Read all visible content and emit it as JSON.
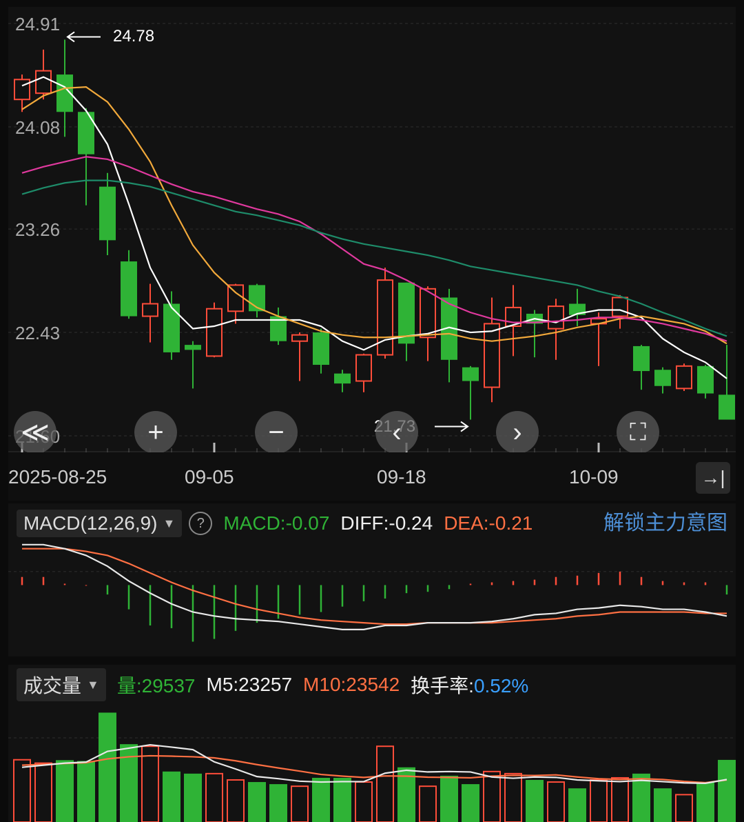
{
  "colors": {
    "up": "#ff4d3a",
    "down": "#2fb336",
    "ma5": "#ffffff",
    "ma10": "#f2a93b",
    "ma20": "#e0399e",
    "ma60": "#1e8c6a",
    "diff": "#e8e8e8",
    "dea": "#ff7043",
    "turnover": "#3aa0ff",
    "link": "#4d8fd6"
  },
  "chart_data": [
    {
      "type": "candlestick",
      "ylim": [
        21.6,
        24.91
      ],
      "y_ticks": [
        "24.91",
        "24.08",
        "23.26",
        "22.43",
        "21.60"
      ],
      "x_ticks": [
        {
          "index": 0,
          "label": "2025-08-25"
        },
        {
          "index": 9,
          "label": "09-05"
        },
        {
          "index": 18,
          "label": "09-18"
        },
        {
          "index": 27,
          "label": "10-09"
        }
      ],
      "candles": [
        {
          "o": 24.3,
          "c": 24.46,
          "h": 24.5,
          "l": 24.2
        },
        {
          "o": 24.35,
          "c": 24.53,
          "h": 24.7,
          "l": 24.3
        },
        {
          "o": 24.5,
          "c": 24.2,
          "h": 24.78,
          "l": 24.0
        },
        {
          "o": 24.2,
          "c": 23.86,
          "h": 24.23,
          "l": 23.45
        },
        {
          "o": 23.6,
          "c": 23.17,
          "h": 23.71,
          "l": 23.05
        },
        {
          "o": 23.0,
          "c": 22.56,
          "h": 23.09,
          "l": 22.54
        },
        {
          "o": 22.56,
          "c": 22.66,
          "h": 22.82,
          "l": 22.35
        },
        {
          "o": 22.66,
          "c": 22.27,
          "h": 22.76,
          "l": 22.21
        },
        {
          "o": 22.33,
          "c": 22.29,
          "h": 22.36,
          "l": 21.98
        },
        {
          "o": 22.24,
          "c": 22.62,
          "h": 22.67,
          "l": 22.23
        },
        {
          "o": 22.6,
          "c": 22.81,
          "h": 22.82,
          "l": 22.5
        },
        {
          "o": 22.81,
          "c": 22.6,
          "h": 22.82,
          "l": 22.55
        },
        {
          "o": 22.56,
          "c": 22.36,
          "h": 22.63,
          "l": 22.33
        },
        {
          "o": 22.36,
          "c": 22.41,
          "h": 22.43,
          "l": 22.04
        },
        {
          "o": 22.43,
          "c": 22.17,
          "h": 22.46,
          "l": 22.1
        },
        {
          "o": 22.1,
          "c": 22.02,
          "h": 22.13,
          "l": 21.95
        },
        {
          "o": 22.04,
          "c": 22.25,
          "h": 22.26,
          "l": 21.95
        },
        {
          "o": 22.25,
          "c": 22.85,
          "h": 22.95,
          "l": 22.22
        },
        {
          "o": 22.83,
          "c": 22.34,
          "h": 22.83,
          "l": 22.2
        },
        {
          "o": 22.39,
          "c": 22.78,
          "h": 22.8,
          "l": 22.2
        },
        {
          "o": 22.71,
          "c": 22.21,
          "h": 22.78,
          "l": 22.03
        },
        {
          "o": 22.15,
          "c": 22.04,
          "h": 22.16,
          "l": 21.73
        },
        {
          "o": 21.99,
          "c": 22.5,
          "h": 22.71,
          "l": 21.87
        },
        {
          "o": 22.48,
          "c": 22.63,
          "h": 22.81,
          "l": 22.24
        },
        {
          "o": 22.58,
          "c": 22.5,
          "h": 22.61,
          "l": 22.23
        },
        {
          "o": 22.46,
          "c": 22.64,
          "h": 22.7,
          "l": 22.21
        },
        {
          "o": 22.66,
          "c": 22.57,
          "h": 22.78,
          "l": 22.48
        },
        {
          "o": 22.5,
          "c": 22.54,
          "h": 22.59,
          "l": 22.16
        },
        {
          "o": 22.56,
          "c": 22.71,
          "h": 22.73,
          "l": 22.46
        },
        {
          "o": 22.32,
          "c": 22.12,
          "h": 22.33,
          "l": 21.97
        },
        {
          "o": 22.13,
          "c": 22.0,
          "h": 22.15,
          "l": 21.94
        },
        {
          "o": 21.98,
          "c": 22.16,
          "h": 22.18,
          "l": 21.96
        },
        {
          "o": 22.16,
          "c": 21.94,
          "h": 22.17,
          "l": 21.9
        },
        {
          "o": 21.93,
          "c": 21.73,
          "h": 22.33,
          "l": 21.73
        }
      ],
      "ma_lines": [
        {
          "key": "ma5",
          "values": [
            24.41,
            24.48,
            24.4,
            24.21,
            23.94,
            23.46,
            22.95,
            22.63,
            22.46,
            22.48,
            22.53,
            22.53,
            22.53,
            22.53,
            22.48,
            22.36,
            22.29,
            22.37,
            22.4,
            22.42,
            22.47,
            22.43,
            22.44,
            22.49,
            22.54,
            22.51,
            22.58,
            22.61,
            22.61,
            22.55,
            22.38,
            22.27,
            22.19,
            22.06
          ]
        },
        {
          "key": "ma10",
          "values": [
            24.22,
            24.33,
            24.39,
            24.4,
            24.28,
            24.06,
            23.8,
            23.45,
            23.13,
            22.91,
            22.75,
            22.63,
            22.56,
            22.5,
            22.44,
            22.41,
            22.39,
            22.39,
            22.4,
            22.41,
            22.42,
            22.38,
            22.36,
            22.38,
            22.4,
            22.43,
            22.47,
            22.5,
            22.54,
            22.56,
            22.53,
            22.5,
            22.44,
            22.34
          ]
        },
        {
          "key": "ma20",
          "values": [
            23.71,
            23.76,
            23.8,
            23.84,
            23.82,
            23.76,
            23.69,
            23.62,
            23.56,
            23.52,
            23.47,
            23.42,
            23.38,
            23.32,
            23.22,
            23.1,
            22.98,
            22.93,
            22.85,
            22.76,
            22.66,
            22.59,
            22.54,
            22.51,
            22.51,
            22.52,
            22.53,
            22.55,
            22.55,
            22.53,
            22.5,
            22.46,
            22.42,
            22.36
          ]
        },
        {
          "key": "ma60",
          "values": [
            23.54,
            23.59,
            23.63,
            23.65,
            23.65,
            23.63,
            23.6,
            23.55,
            23.5,
            23.45,
            23.4,
            23.37,
            23.33,
            23.29,
            23.23,
            23.18,
            23.14,
            23.11,
            23.08,
            23.05,
            23.01,
            22.96,
            22.93,
            22.9,
            22.87,
            22.84,
            22.81,
            22.76,
            22.72,
            22.66,
            22.59,
            22.53,
            22.46,
            22.4
          ]
        }
      ],
      "annotations": [
        {
          "text": "24.78",
          "index": 2,
          "value": 24.78,
          "side": "right"
        },
        {
          "text": "21.73",
          "index": 21,
          "value": 21.73,
          "side": "left"
        }
      ]
    },
    {
      "type": "macd",
      "params": "MACD(12,26,9)",
      "latest": {
        "macd": "MACD:-0.07",
        "diff": "DIFF:-0.24",
        "dea": "DEA:-0.21"
      },
      "ylim": [
        -0.52,
        0.34
      ],
      "hist": [
        0.06,
        0.06,
        0.01,
        0,
        -0.07,
        -0.18,
        -0.3,
        -0.32,
        -0.42,
        -0.4,
        -0.34,
        -0.28,
        -0.25,
        -0.22,
        -0.2,
        -0.16,
        -0.12,
        -0.1,
        -0.06,
        -0.05,
        -0.03,
        0.01,
        0.02,
        0.03,
        0.04,
        0.06,
        0.07,
        0.09,
        0.1,
        0.06,
        0.03,
        0.02,
        0.02,
        -0.07
      ],
      "diff": [
        0.3,
        0.3,
        0.27,
        0.22,
        0.14,
        0.03,
        -0.06,
        -0.14,
        -0.2,
        -0.23,
        -0.25,
        -0.26,
        -0.27,
        -0.29,
        -0.31,
        -0.33,
        -0.33,
        -0.3,
        -0.3,
        -0.28,
        -0.28,
        -0.28,
        -0.27,
        -0.25,
        -0.22,
        -0.21,
        -0.18,
        -0.17,
        -0.15,
        -0.16,
        -0.18,
        -0.18,
        -0.2,
        -0.23
      ],
      "dea": [
        0.27,
        0.27,
        0.27,
        0.25,
        0.22,
        0.16,
        0.09,
        0.02,
        -0.04,
        -0.09,
        -0.14,
        -0.18,
        -0.21,
        -0.24,
        -0.26,
        -0.27,
        -0.28,
        -0.29,
        -0.29,
        -0.28,
        -0.28,
        -0.28,
        -0.28,
        -0.27,
        -0.26,
        -0.25,
        -0.23,
        -0.22,
        -0.2,
        -0.2,
        -0.2,
        -0.2,
        -0.21,
        -0.21
      ]
    },
    {
      "type": "volume",
      "label": "成交量",
      "latest": {
        "vol_label": "量:",
        "vol_value": "29537",
        "m5": "M5:23257",
        "m10": "M10:23542",
        "turnover_label": "换手率:",
        "turnover_value": "0.52%"
      },
      "ylim": [
        0,
        60000
      ],
      "values": [
        29600,
        28000,
        29400,
        29000,
        52000,
        37000,
        36000,
        24000,
        23000,
        23000,
        20000,
        19000,
        18000,
        17000,
        21000,
        21000,
        19000,
        36000,
        26000,
        17000,
        22000,
        18000,
        24000,
        23000,
        20000,
        19000,
        16000,
        20000,
        21000,
        23000,
        16000,
        13000,
        19000,
        29537
      ],
      "m5": [
        26000,
        27000,
        28000,
        28500,
        33600,
        35100,
        36700,
        35600,
        34400,
        28600,
        25200,
        21600,
        20600,
        19400,
        19000,
        19200,
        19200,
        23200,
        24600,
        23800,
        24000,
        23800,
        21400,
        20800,
        21400,
        21200,
        20000,
        19600,
        19200,
        19800,
        19200,
        18600,
        18400,
        20200
      ],
      "m10": [
        27000,
        27400,
        27800,
        28200,
        30000,
        31000,
        31500,
        31300,
        31000,
        30500,
        29100,
        27300,
        25700,
        24200,
        22600,
        21800,
        21200,
        21900,
        21800,
        21300,
        21200,
        21000,
        21800,
        22200,
        22100,
        22400,
        21400,
        20600,
        20200,
        20600,
        20200,
        19300,
        18700,
        20000
      ]
    }
  ],
  "controls": {
    "rewind": "≪",
    "zoom_in": "+",
    "zoom_out": "−",
    "prev": "‹",
    "next": "›",
    "fullscreen": "⛶",
    "jump_end": "→|"
  },
  "macd_header": {
    "link": "解锁主力意图"
  }
}
